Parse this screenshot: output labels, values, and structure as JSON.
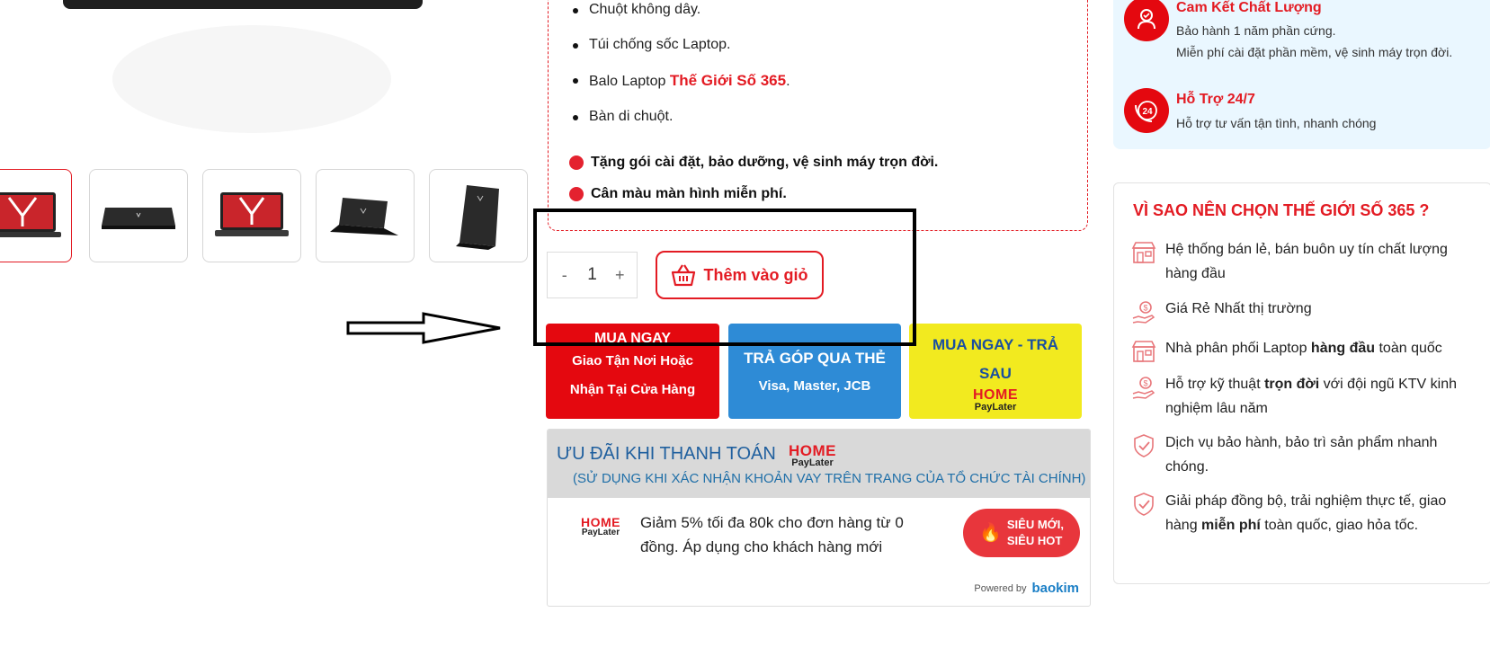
{
  "gallery": {
    "thumbnail_count": 5,
    "active_index": 0
  },
  "promo": {
    "items": [
      {
        "text": "Chuột không dây."
      },
      {
        "text": "Túi chống sốc Laptop."
      },
      {
        "text_before": "Balo Laptop ",
        "highlight": "Thế Giới Số 365",
        "text_after": "."
      },
      {
        "text": "Bàn di chuột."
      }
    ],
    "gifts": [
      "Tặng gói cài đặt, bảo dưỡng, vệ sinh máy trọn đời.",
      "Cân màu màn hình miễn phí."
    ]
  },
  "cart": {
    "minus": "-",
    "quantity": "1",
    "plus": "+",
    "add_label": "Thêm vào giỏ"
  },
  "buy_buttons": {
    "buy_now": {
      "title": "MUA NGAY",
      "line1": "Giao Tận Nơi Hoặc",
      "line2": "Nhận Tại Cửa Hàng"
    },
    "installment": {
      "title": "TRẢ GÓP QUA THẺ",
      "subtitle": "Visa, Master, JCB"
    },
    "paylater": {
      "title_line1": "MUA NGAY - TRẢ",
      "title_line2": "SAU",
      "logo_top": "HOME",
      "logo_bottom": "PayLater"
    }
  },
  "payment_offer": {
    "title": "ƯU ĐÃI KHI THANH TOÁN",
    "logo_top": "HOME",
    "logo_bottom": "PayLater",
    "subtitle": "(SỬ DỤNG KHI XÁC NHẬN KHOẢN VAY TRÊN TRANG CỦA TỔ CHỨC TÀI CHÍNH)",
    "offer_text": "Giảm 5% tối đa 80k cho đơn hàng từ 0 đồng. Áp dụng cho khách hàng mới",
    "badge_line1": "SIÊU MỚI,",
    "badge_line2": "SIÊU HOT",
    "powered_by": "Powered by",
    "powered_brand": "baokim"
  },
  "commitments": [
    {
      "title": "Cam Kết Chất Lượng",
      "lines": [
        "Bảo hành 1 năm phần cứng.",
        "Miễn phí cài đặt phần mềm, vệ sinh máy trọn đời."
      ],
      "icon": "quality-icon"
    },
    {
      "title": "Hỗ Trợ 24/7",
      "lines": [
        "Hỗ trợ tư vấn tận tình, nhanh chóng"
      ],
      "icon": "support-24-icon",
      "icon_text": "24"
    }
  ],
  "why": {
    "title": "VÌ SAO NÊN CHỌN THẾ GIỚI SỐ 365 ?",
    "items": [
      {
        "icon": "store-icon",
        "parts": [
          {
            "t": "Hệ thống bán lẻ, bán buôn uy tín chất lượng hàng đầu"
          }
        ]
      },
      {
        "icon": "money-hand-icon",
        "parts": [
          {
            "t": "Giá Rẻ Nhất thị trường"
          }
        ]
      },
      {
        "icon": "store-icon",
        "parts": [
          {
            "t": "Nhà phân phối Laptop "
          },
          {
            "t": "hàng đầu",
            "b": true
          },
          {
            "t": " toàn quốc"
          }
        ]
      },
      {
        "icon": "money-hand-icon",
        "parts": [
          {
            "t": "Hỗ trợ kỹ thuật "
          },
          {
            "t": "trọn đời",
            "b": true
          },
          {
            "t": " với đội ngũ KTV kinh nghiệm lâu năm"
          }
        ]
      },
      {
        "icon": "shield-check-icon",
        "parts": [
          {
            "t": "Dịch vụ bảo hành, bảo trì sản phẩm nhanh chóng."
          }
        ]
      },
      {
        "icon": "shield-check-icon",
        "parts": [
          {
            "t": "Giải pháp đồng bộ, trải nghiệm thực tế, giao hàng "
          },
          {
            "t": "miễn phí",
            "b": true
          },
          {
            "t": " toàn quốc, giao hỏa tốc."
          }
        ]
      }
    ]
  },
  "colors": {
    "brand_red": "#e31b23",
    "installment_blue": "#2e8bd6",
    "paylater_yellow": "#f2ea1f",
    "commit_bg": "#eaf7ff"
  }
}
